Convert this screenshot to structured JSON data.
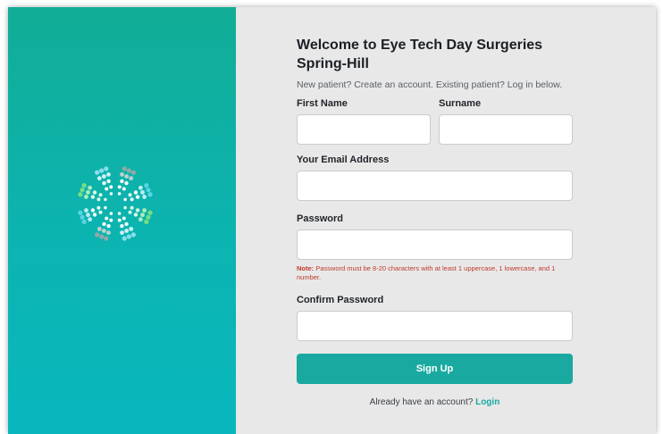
{
  "brand": {
    "left_panel_colors": [
      "#11ad96",
      "#08b7bd"
    ],
    "accent": "#1aa9a0",
    "logo_icon": "flower-dots-logo"
  },
  "header": {
    "title": "Welcome to Eye Tech Day Surgeries Spring-Hill",
    "subtitle": "New patient? Create an account. Existing patient? Log in below."
  },
  "form": {
    "first_name_label": "First Name",
    "first_name_value": "",
    "surname_label": "Surname",
    "surname_value": "",
    "email_label": "Your Email Address",
    "email_value": "",
    "password_label": "Password",
    "password_value": "",
    "password_note_prefix": "Note:",
    "password_note_text": " Password must be 8-20 characters with at least 1 uppercase, 1 lowercase, and 1 number.",
    "confirm_password_label": "Confirm Password",
    "confirm_password_value": "",
    "submit_label": "Sign Up"
  },
  "footer": {
    "prompt": "Already have an account?",
    "login_label": "Login"
  }
}
